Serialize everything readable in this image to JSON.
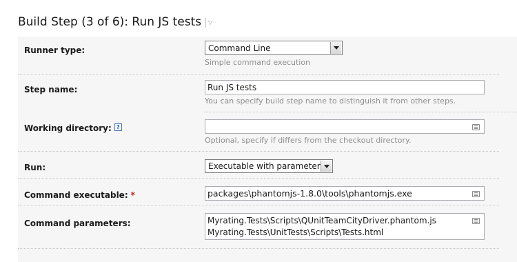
{
  "header": {
    "title": "Build Step (3 of 6): Run JS tests",
    "separator": "|",
    "dropdown_glyph": "▽"
  },
  "icons": {
    "help": "?",
    "required": "*"
  },
  "form": {
    "runner_type": {
      "label": "Runner type:",
      "value": "Command Line",
      "note": "Simple command execution"
    },
    "step_name": {
      "label": "Step name:",
      "value": "Run JS tests",
      "note": "You can specify build step name to distinguish it from other steps."
    },
    "working_directory": {
      "label": "Working directory:",
      "value": "",
      "note": "Optional, specify if differs from the checkout directory."
    },
    "run": {
      "label": "Run:",
      "value": "Executable with parameters"
    },
    "command_executable": {
      "label": "Command executable:",
      "value": "packages\\phantomjs-1.8.0\\tools\\phantomjs.exe"
    },
    "command_parameters": {
      "label": "Command parameters:",
      "line1": "Myrating.Tests\\Scripts\\QUnitTeamCityDriver.phantom.js",
      "line2": "Myrating.Tests\\UnitTests\\Scripts\\Tests.html"
    }
  },
  "colors": {
    "panel_bg": "#f6f6f6",
    "required": "#d31818",
    "note": "#8c8c8c"
  }
}
